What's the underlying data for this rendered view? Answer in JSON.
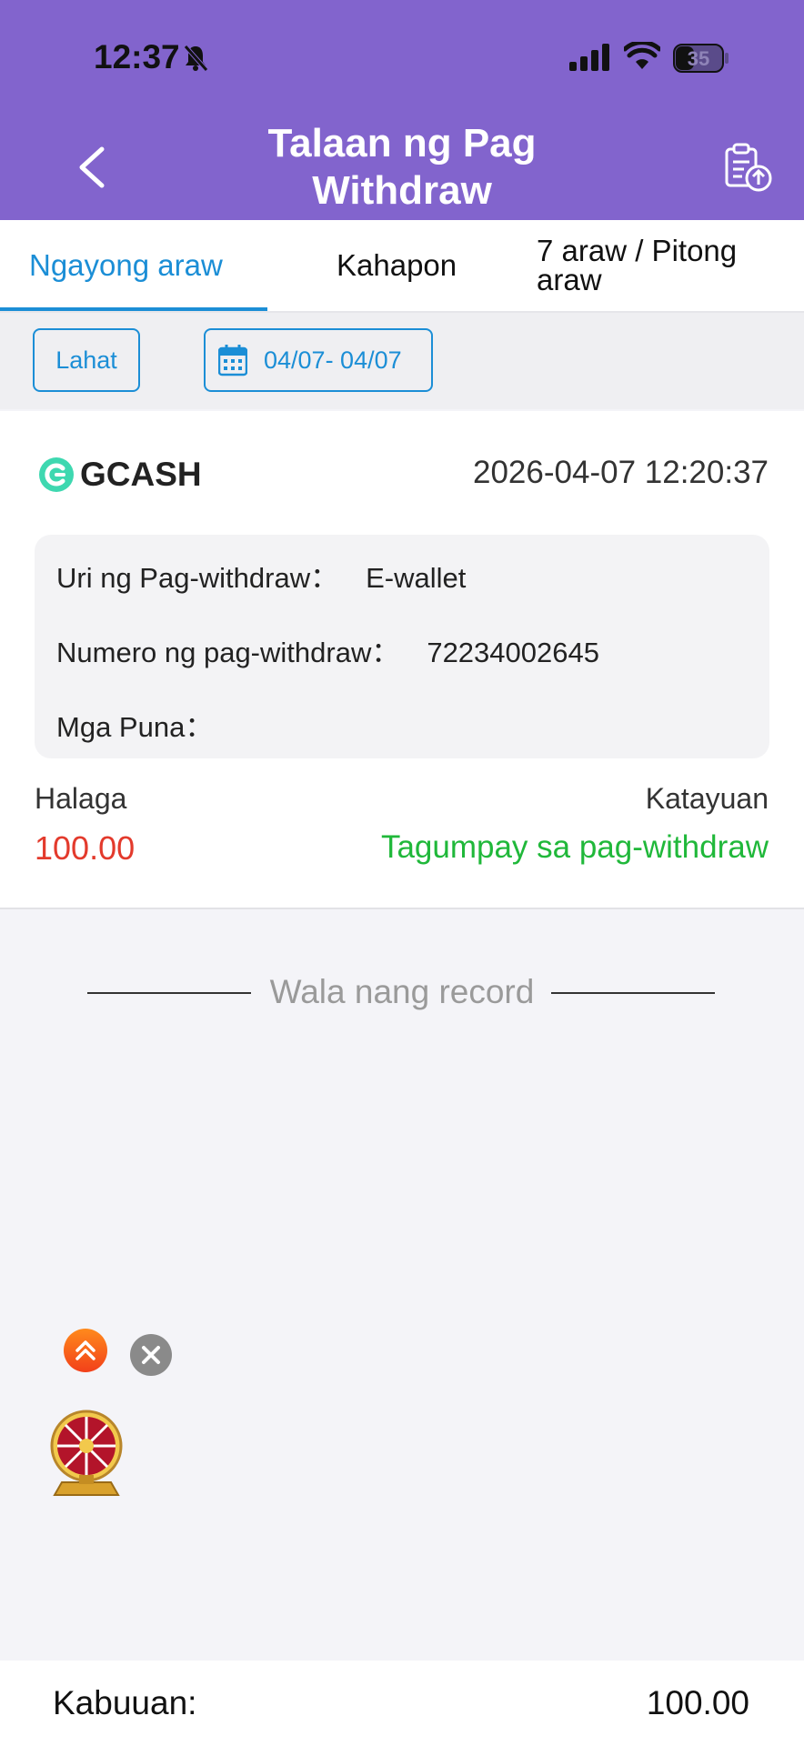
{
  "status_bar": {
    "time": "12:37",
    "battery": "35"
  },
  "header": {
    "title": "Talaan ng Pag Withdraw"
  },
  "tabs": [
    {
      "label": "Ngayong araw",
      "active": true
    },
    {
      "label": "Kahapon",
      "active": false
    },
    {
      "label": "7 araw / Pitong araw",
      "active": false
    }
  ],
  "filters": {
    "all_label": "Lahat",
    "date_range": "04/07- 04/07"
  },
  "record": {
    "provider": "GCASH",
    "datetime": "2026-04-07 12:20:37",
    "type_label": "Uri ng Pag-withdraw：",
    "type_value": "E-wallet",
    "number_label": "Numero ng pag-withdraw：",
    "number_value": "72234002645",
    "remarks_label": "Mga Puna：",
    "remarks_value": "",
    "amount_label": "Halaga",
    "amount_value": "100.00",
    "status_label": "Katayuan",
    "status_value": "Tagumpay sa pag-withdraw"
  },
  "no_more": "Wala nang record",
  "footer": {
    "total_label": "Kabuuan:",
    "total_value": "100.00"
  },
  "colors": {
    "header": "#8264cd",
    "accent": "#1b8ed6",
    "amount": "#e33a2c",
    "success": "#20b83a"
  }
}
